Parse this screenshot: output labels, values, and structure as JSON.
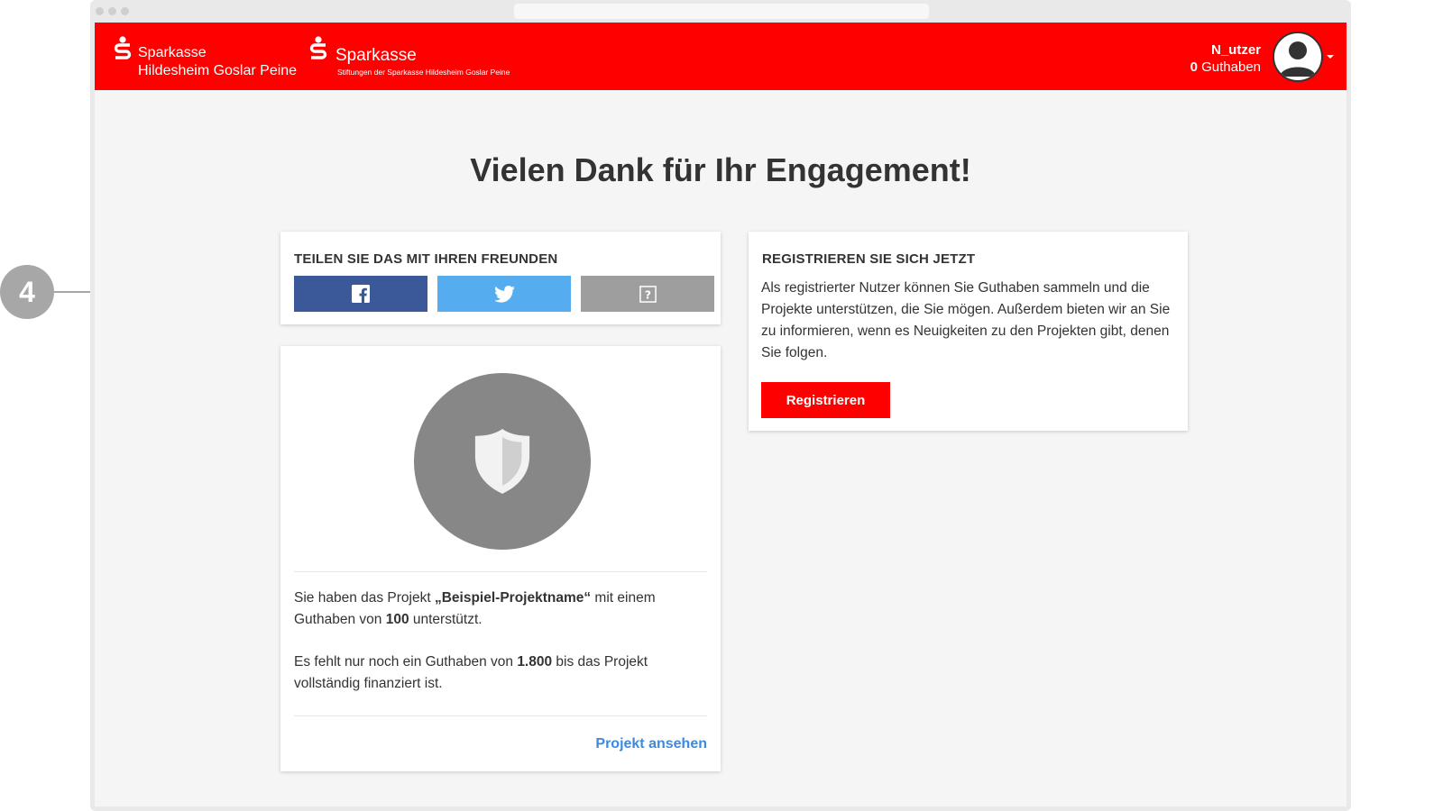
{
  "header": {
    "logo_primary": {
      "brand": "Sparkasse",
      "sub": "Hildesheim Goslar Peine"
    },
    "logo_secondary": {
      "brand": "Sparkasse",
      "sub": "Stiftungen der Sparkasse Hildesheim Goslar Peine"
    },
    "user": {
      "name": "N_utzer",
      "credit_value": "0",
      "credit_label": "Guthaben"
    }
  },
  "page": {
    "title": "Vielen Dank für Ihr Engagement!"
  },
  "share": {
    "heading": "TEILEN SIE DAS MIT IHREN FREUNDEN",
    "buttons": [
      {
        "network": "facebook",
        "icon": "facebook-icon",
        "color": "#3b5998"
      },
      {
        "network": "twitter",
        "icon": "twitter-icon",
        "color": "#55acee"
      },
      {
        "network": "other",
        "icon": "help-icon",
        "color": "#9e9e9e"
      }
    ]
  },
  "register": {
    "heading": "REGISTRIEREN SIE SICH JETZT",
    "text": "Als registrierter Nutzer können Sie Guthaben sammeln und die Projekte unterstützen, die Sie mögen. Außerdem bieten wir an Sie zu informieren, wenn es Neuigkeiten zu den Projekten gibt, denen Sie folgen.",
    "button_label": "Registrieren"
  },
  "project": {
    "icon": "shield-icon",
    "support": {
      "prefix": "Sie haben das Projekt ",
      "name": "„Beispiel-Projektname“",
      "middle": " mit einem Guthaben von ",
      "amount": "100",
      "suffix": " unterstützt."
    },
    "remaining": {
      "prefix": "Es fehlt nur noch ein Guthaben von ",
      "amount": "1.800",
      "suffix": " bis das Projekt vollständig finanziert ist."
    },
    "link_label": "Projekt ansehen"
  },
  "annotation": {
    "number": "4"
  },
  "colors": {
    "brand_red": "#ff0000",
    "link_blue": "#3c89de",
    "facebook": "#3b5998",
    "twitter": "#55acee"
  }
}
